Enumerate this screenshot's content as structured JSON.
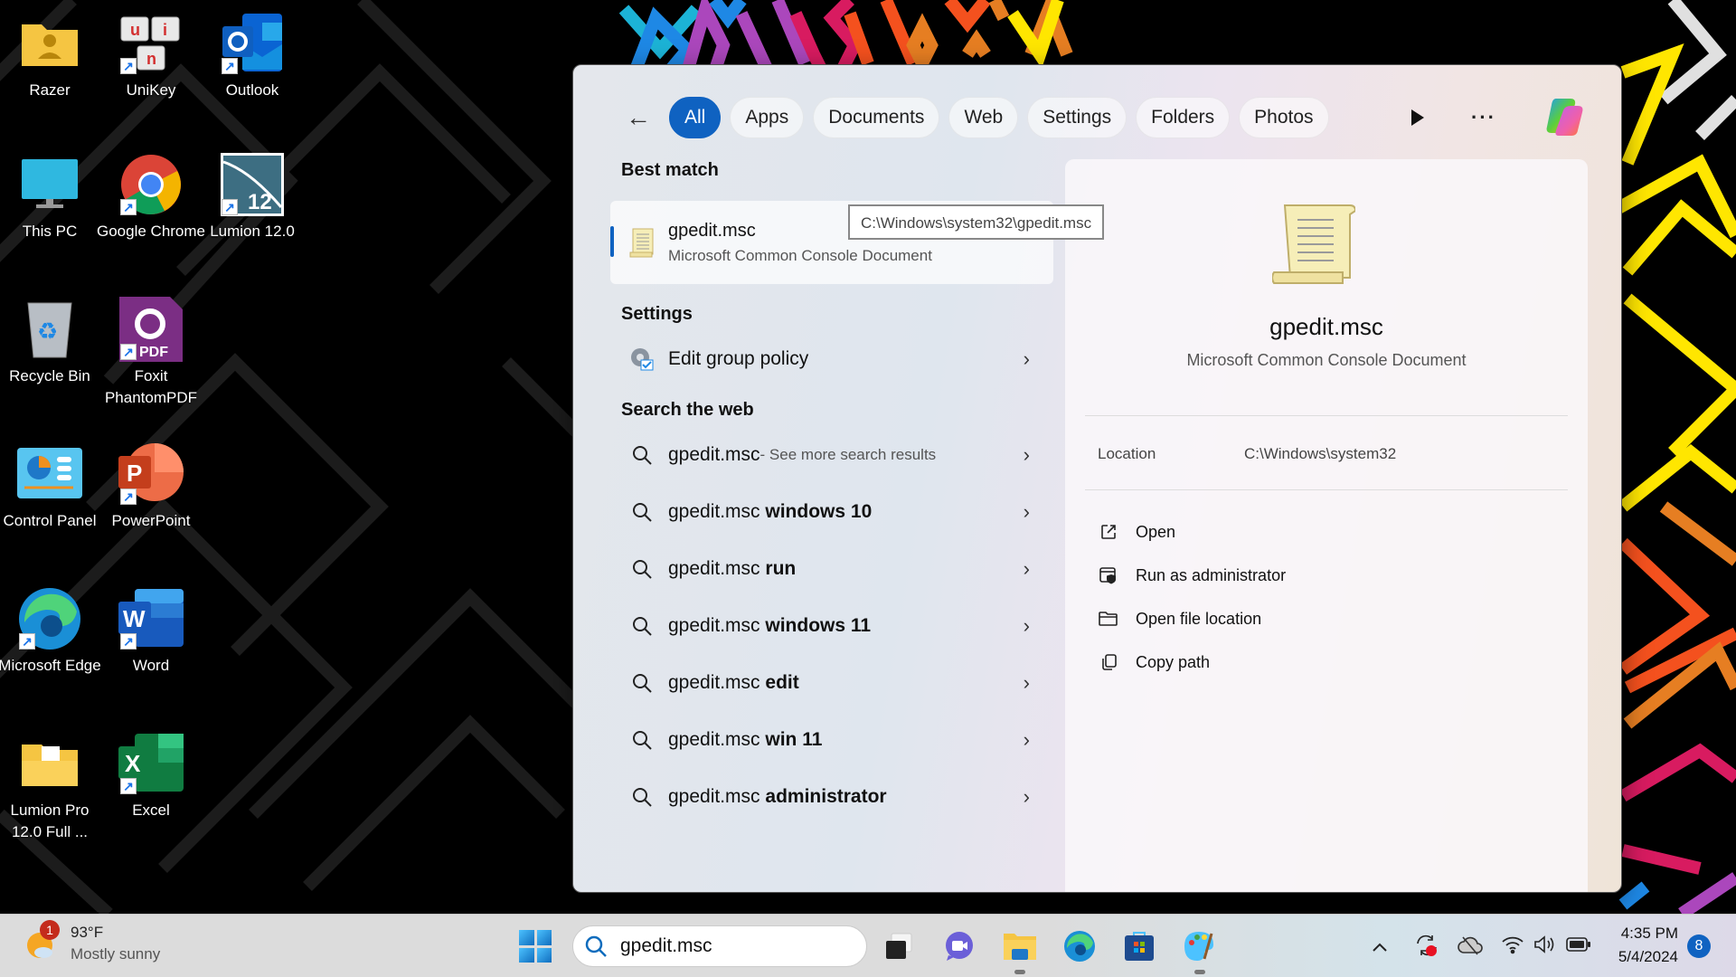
{
  "desktop": {
    "icons": [
      {
        "label": "Razer",
        "icon": "folder-user-icon"
      },
      {
        "label": "UniKey",
        "icon": "unikey-icon"
      },
      {
        "label": "Outlook",
        "icon": "outlook-icon"
      },
      {
        "label": "This PC",
        "icon": "monitor-icon"
      },
      {
        "label": "Google Chrome",
        "icon": "chrome-icon"
      },
      {
        "label": "Lumion 12.0",
        "icon": "lumion-icon"
      },
      {
        "label": "Recycle Bin",
        "icon": "recycle-bin-icon"
      },
      {
        "label": "Foxit PhantomPDF",
        "icon": "foxit-pdf-icon"
      },
      {
        "label": "Control Panel",
        "icon": "control-panel-icon"
      },
      {
        "label": "PowerPoint",
        "icon": "powerpoint-icon"
      },
      {
        "label": "Microsoft Edge",
        "icon": "edge-icon"
      },
      {
        "label": "Word",
        "icon": "word-icon"
      },
      {
        "label": "Lumion Pro 12.0 Full ...",
        "icon": "folder-icon"
      },
      {
        "label": "Excel",
        "icon": "excel-icon"
      }
    ]
  },
  "search": {
    "filters": [
      "All",
      "Apps",
      "Documents",
      "Web",
      "Settings",
      "Folders",
      "Photos"
    ],
    "active_filter": "All",
    "best_match_heading": "Best match",
    "best_match": {
      "title": "gpedit.msc",
      "subtitle": "Microsoft Common Console Document"
    },
    "tooltip": "C:\\Windows\\system32\\gpedit.msc",
    "settings_heading": "Settings",
    "settings_item": "Edit group policy",
    "web_heading": "Search the web",
    "web_first": {
      "query": "gpedit.msc",
      "suffix": " - See more search results"
    },
    "web_results": [
      {
        "prefix": "gpedit.msc ",
        "bold": "windows 10"
      },
      {
        "prefix": "gpedit.msc ",
        "bold": "run"
      },
      {
        "prefix": "gpedit.msc ",
        "bold": "windows 11"
      },
      {
        "prefix": "gpedit.msc ",
        "bold": "edit"
      },
      {
        "prefix": "gpedit.msc ",
        "bold": "win 11"
      },
      {
        "prefix": "gpedit.msc ",
        "bold": "administrator"
      }
    ],
    "detail": {
      "title": "gpedit.msc",
      "subtitle": "Microsoft Common Console Document",
      "location_label": "Location",
      "location_value": "C:\\Windows\\system32",
      "actions": [
        "Open",
        "Run as administrator",
        "Open file location",
        "Copy path"
      ]
    }
  },
  "taskbar": {
    "weather": {
      "temp": "93°F",
      "condition": "Mostly sunny",
      "badge": "1"
    },
    "search_value": "gpedit.msc",
    "apps": [
      "task-view",
      "teams-meet",
      "file-explorer",
      "edge",
      "microsoft-store",
      "paint"
    ],
    "time": "4:35 PM",
    "date": "5/4/2024",
    "notification_count": "8"
  },
  "colors": {
    "accent": "#0f62c1",
    "notification": "#c42b1c"
  }
}
